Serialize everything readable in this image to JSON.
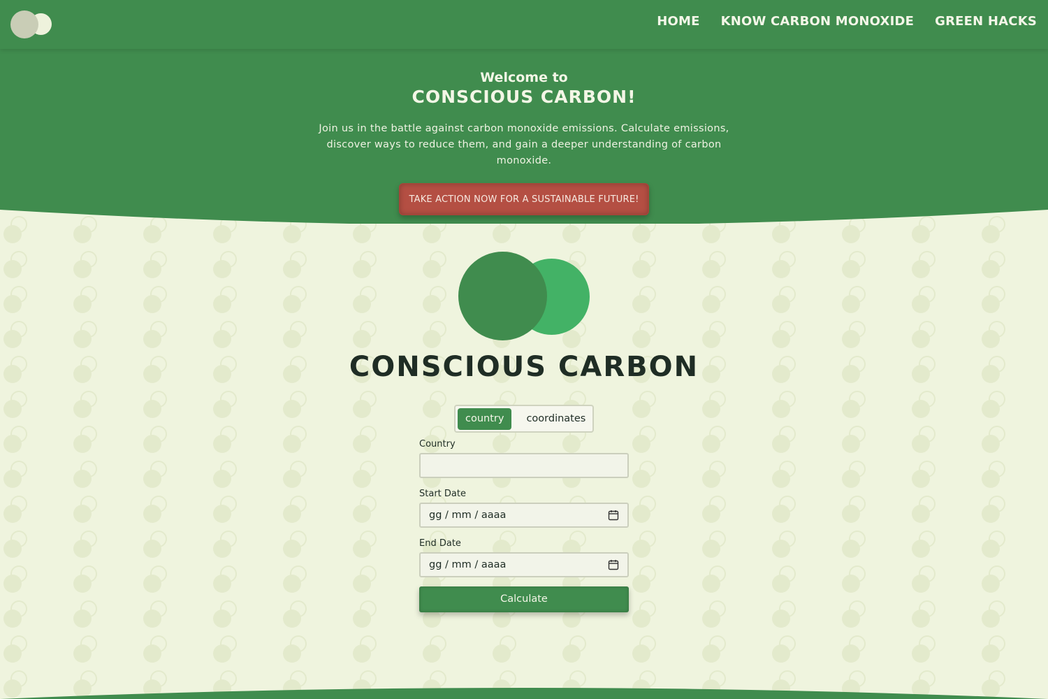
{
  "nav": {
    "links": [
      "HOME",
      "KNOW CARBON MONOXIDE",
      "GREEN HACKS"
    ]
  },
  "hero": {
    "welcome": "Welcome to",
    "title": "CONSCIOUS CARBON!",
    "description": "Join us in the battle against carbon monoxide emissions. Calculate emissions, discover ways to reduce them, and gain a deeper understanding of carbon monoxide.",
    "cta_label": "TAKE ACTION NOW FOR A SUSTAINABLE FUTURE!"
  },
  "brand": {
    "title": "CONSCIOUS CARBON"
  },
  "mode_toggle": {
    "options": [
      "country",
      "coordinates"
    ],
    "selected": "country"
  },
  "form": {
    "country_label": "Country",
    "country_value": "",
    "start_label": "Start Date",
    "start_placeholder": "gg / mm / aaaa",
    "end_label": "End Date",
    "end_placeholder": "gg / mm / aaaa",
    "calculate_label": "Calculate"
  },
  "colors": {
    "primary_green": "#408c4e",
    "accent_green": "#43b266",
    "background": "#eff4de",
    "cta_red": "#b44f43"
  }
}
